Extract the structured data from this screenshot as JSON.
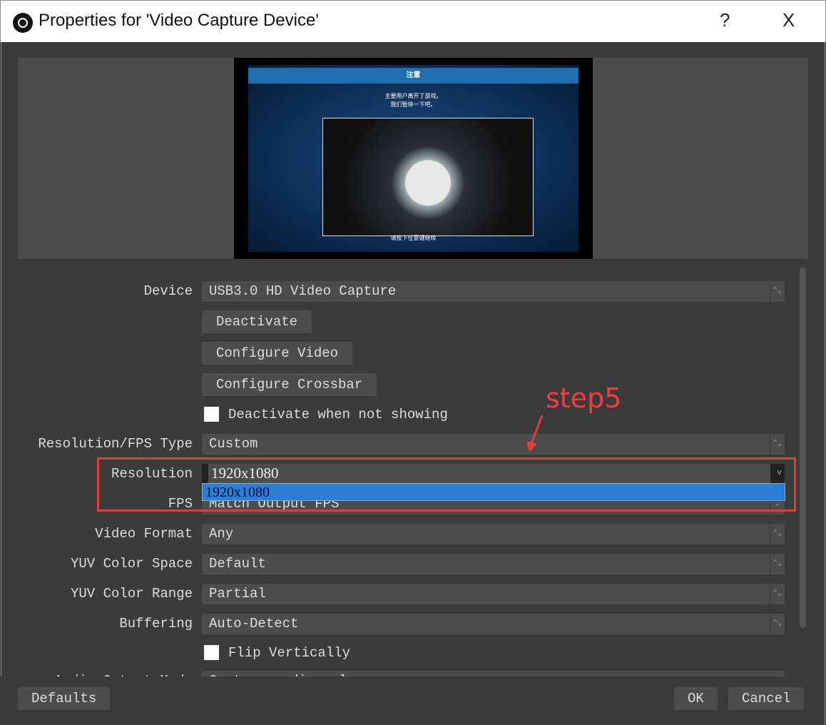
{
  "window": {
    "title": "Properties for 'Video Capture Device'",
    "help": "?",
    "close": "X"
  },
  "preview": {
    "header": "注意",
    "message_line1": "主要用户离开了游戏。",
    "message_line2": "我们暂停一下吧。",
    "footer": "请按下任意键继续"
  },
  "form": {
    "device": {
      "label": "Device",
      "value": "USB3.0 HD Video Capture"
    },
    "deactivate": "Deactivate",
    "configure_video": "Configure Video",
    "configure_crossbar": "Configure Crossbar",
    "deactivate_not_showing": {
      "label": "Deactivate when not showing",
      "checked": false
    },
    "res_fps_type": {
      "label": "Resolution/FPS Type",
      "value": "Custom"
    },
    "resolution": {
      "label": "Resolution",
      "value": "1920x1080",
      "options": [
        "1920x1080"
      ]
    },
    "fps": {
      "label": "FPS",
      "value": "Match Output FPS"
    },
    "video_format": {
      "label": "Video Format",
      "value": "Any"
    },
    "yuv_space": {
      "label": "YUV Color Space",
      "value": "Default"
    },
    "yuv_range": {
      "label": "YUV Color Range",
      "value": "Partial"
    },
    "buffering": {
      "label": "Buffering",
      "value": "Auto-Detect"
    },
    "flip": {
      "label": "Flip Vertically",
      "checked": false
    },
    "audio_output": {
      "label": "Audio Output Mode",
      "value": "Capture audio only"
    }
  },
  "annotation": {
    "text": "step5",
    "color": "#e03c3c"
  },
  "footer": {
    "defaults": "Defaults",
    "ok": "OK",
    "cancel": "Cancel"
  },
  "colors": {
    "highlight": "#2b7fd8",
    "background": "#3b3b3b"
  }
}
